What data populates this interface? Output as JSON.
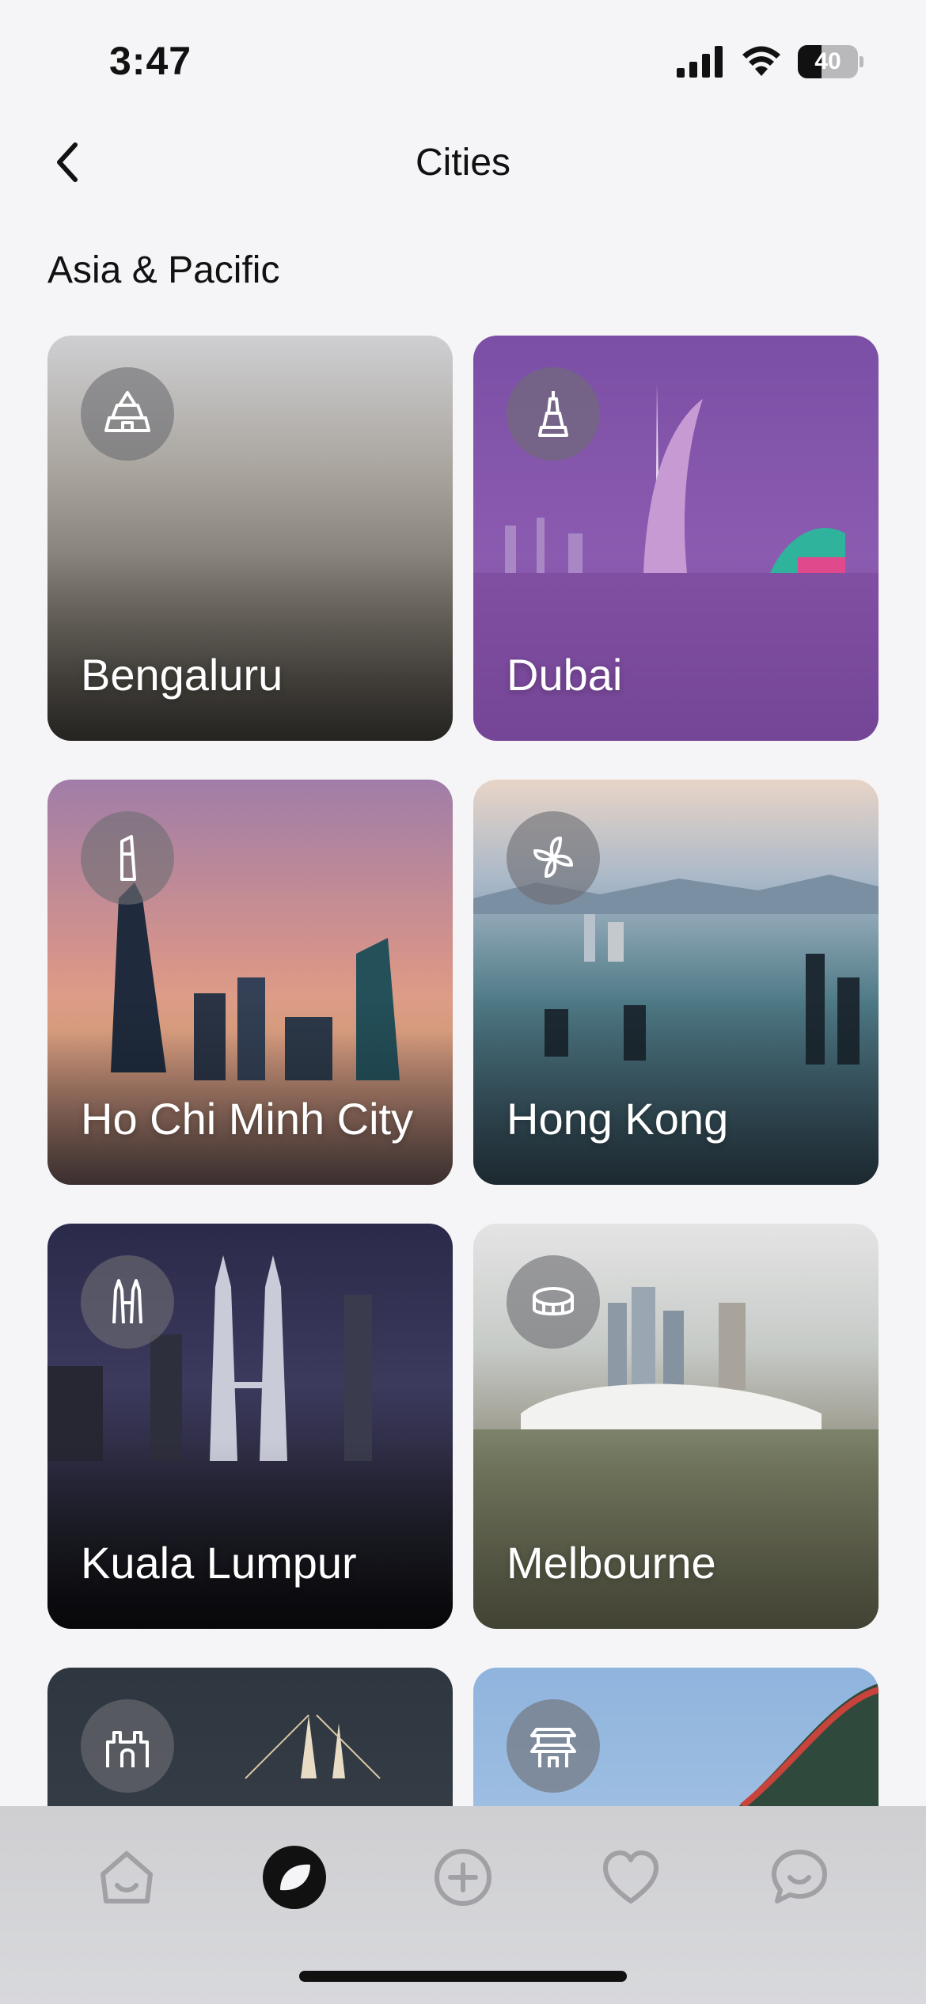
{
  "status_bar": {
    "time": "3:47",
    "battery_level": "40",
    "battery_percent": 40
  },
  "nav": {
    "title": "Cities",
    "back_icon": "chevron-left-icon"
  },
  "section": {
    "title": "Asia & Pacific"
  },
  "cities": [
    {
      "name": "Bengaluru",
      "icon": "temple-icon"
    },
    {
      "name": "Dubai",
      "icon": "burj-khalifa-icon"
    },
    {
      "name": "Ho Chi Minh City",
      "icon": "tower-icon"
    },
    {
      "name": "Hong Kong",
      "icon": "bauhinia-flower-icon"
    },
    {
      "name": "Kuala Lumpur",
      "icon": "twin-towers-icon"
    },
    {
      "name": "Melbourne",
      "icon": "stadium-icon"
    },
    {
      "name": "",
      "icon": "gateway-icon"
    },
    {
      "name": "",
      "icon": "pagoda-icon"
    }
  ],
  "tabs": [
    {
      "name": "home",
      "icon": "home-icon",
      "active": false
    },
    {
      "name": "explore",
      "icon": "compass-icon",
      "active": true
    },
    {
      "name": "add",
      "icon": "add-circle-icon",
      "active": false
    },
    {
      "name": "favorites",
      "icon": "heart-icon",
      "active": false
    },
    {
      "name": "messages",
      "icon": "chat-icon",
      "active": false
    }
  ],
  "colors": {
    "background": "#f5f5f7",
    "text": "#111111",
    "tab_inactive": "#a0a0a5",
    "tab_active": "#111111"
  }
}
